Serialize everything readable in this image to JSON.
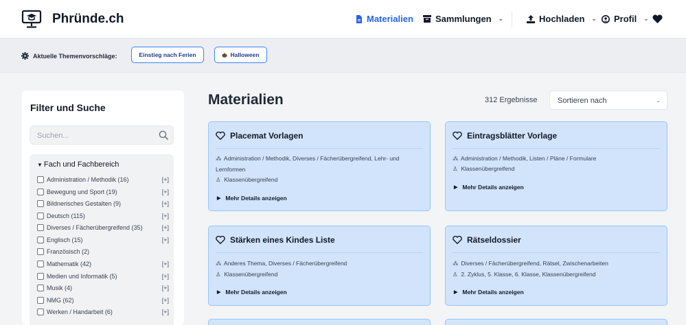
{
  "header": {
    "brand": "Phründe.ch",
    "nav": {
      "materialien": "Materialien",
      "sammlungen": "Sammlungen",
      "hochladen": "Hochladen",
      "profil": "Profil"
    }
  },
  "suggestions": {
    "label": "Aktuelle Themenvorschläge:",
    "items": [
      "Einstieg nach Ferien",
      "Halloween"
    ]
  },
  "sidebar": {
    "title": "Filter und Suche",
    "search_placeholder": "Suchen...",
    "facet_title": "Fach und Fachbereich",
    "items": [
      {
        "label": "Administration / Methodik (16)",
        "expand": "[+]"
      },
      {
        "label": "Bewegung und Sport (19)",
        "expand": "[+]"
      },
      {
        "label": "Bildnerisches Gestalten (9)",
        "expand": "[+]"
      },
      {
        "label": "Deutsch (115)",
        "expand": "[+]"
      },
      {
        "label": "Diverses / Fächerübergreifend (35)",
        "expand": "[+]"
      },
      {
        "label": "Englisch (15)",
        "expand": "[+]"
      },
      {
        "label": "Französisch (2)",
        "expand": ""
      },
      {
        "label": "Mathematik (42)",
        "expand": "[+]"
      },
      {
        "label": "Medien und Informatik (5)",
        "expand": "[+]"
      },
      {
        "label": "Musik (4)",
        "expand": "[+]"
      },
      {
        "label": "NMG (62)",
        "expand": "[+]"
      },
      {
        "label": "Werken / Handarbeit (6)",
        "expand": "[+]"
      }
    ]
  },
  "main": {
    "title": "Materialien",
    "results": "312 Ergebnisse",
    "sort_label": "Sortieren nach",
    "details_label": "Mehr Details anzeigen",
    "cards": [
      {
        "title": "Placemat Vorlagen",
        "categories": "Administration / Methodik, Diverses / Fächerübergreifend, Lehr- und Lernformen",
        "levels": "Klassenübergreifend"
      },
      {
        "title": "Eintragsblätter Vorlage",
        "categories": "Administration / Methodik, Listen / Pläne / Formulare",
        "levels": "Klassenübergreifend"
      },
      {
        "title": "Stärken eines Kindes Liste",
        "categories": "Anderes Thema, Diverses / Fächerübergreifend",
        "levels": "Klassenübergreifend"
      },
      {
        "title": "Rätseldossier",
        "categories": "Diverses / Fächerübergreifend, Rätsel, Zwischenarbeiten",
        "levels": "2. Zyklus, 5. Klasse, 6. Klasse, Klassenübergreifend"
      }
    ]
  },
  "colors": {
    "accent": "#2563eb",
    "card_bg": "#d2e4fb",
    "card_border": "#93c5fd",
    "page_bg": "#f3f4f6"
  },
  "icons": [
    "monitor-graduation-logo",
    "file-icon",
    "archive-icon",
    "upload-icon",
    "user-circle-icon",
    "heart-icon",
    "gear-icon",
    "pumpkin-icon",
    "search-icon",
    "sitemap-icon",
    "person-icon",
    "caret-right-icon"
  ]
}
